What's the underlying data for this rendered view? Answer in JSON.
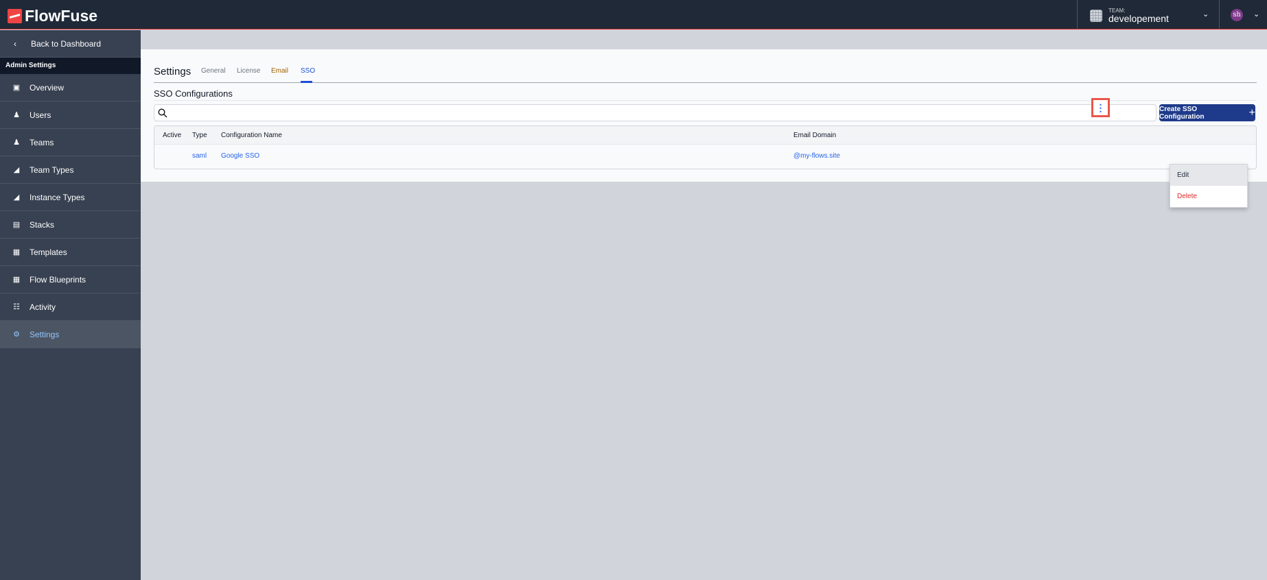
{
  "header": {
    "brand": "FlowFuse",
    "team_label": "TEAM:",
    "team_name": "developement",
    "avatar_initials": "sh"
  },
  "sidebar": {
    "back": "Back to Dashboard",
    "section": "Admin Settings",
    "items": [
      {
        "label": "Overview",
        "icon": "server-icon"
      },
      {
        "label": "Users",
        "icon": "users-icon"
      },
      {
        "label": "Teams",
        "icon": "user-group-icon"
      },
      {
        "label": "Team Types",
        "icon": "shapes-icon"
      },
      {
        "label": "Instance Types",
        "icon": "shapes-icon"
      },
      {
        "label": "Stacks",
        "icon": "desktop-icon"
      },
      {
        "label": "Templates",
        "icon": "template-icon"
      },
      {
        "label": "Flow Blueprints",
        "icon": "template-icon"
      },
      {
        "label": "Activity",
        "icon": "database-icon"
      },
      {
        "label": "Settings",
        "icon": "cog-icon",
        "active": true
      }
    ]
  },
  "main": {
    "title": "Settings",
    "tabs": [
      {
        "label": "General"
      },
      {
        "label": "License"
      },
      {
        "label": "Email"
      },
      {
        "label": "SSO",
        "active": true
      }
    ],
    "section_title": "SSO Configurations",
    "search_placeholder": "",
    "create_button": "Create SSO Configuration",
    "table": {
      "columns": [
        "Active",
        "Type",
        "Configuration Name",
        "Email Domain"
      ],
      "rows": [
        {
          "active": "",
          "type": "saml",
          "name": "Google SSO",
          "domain": "@my-flows.site"
        }
      ]
    },
    "menu": {
      "items": [
        "Edit",
        "Delete"
      ]
    }
  },
  "colors": {
    "accent": "#1e3a8a",
    "danger": "#dc2626",
    "link": "#2563eb"
  }
}
